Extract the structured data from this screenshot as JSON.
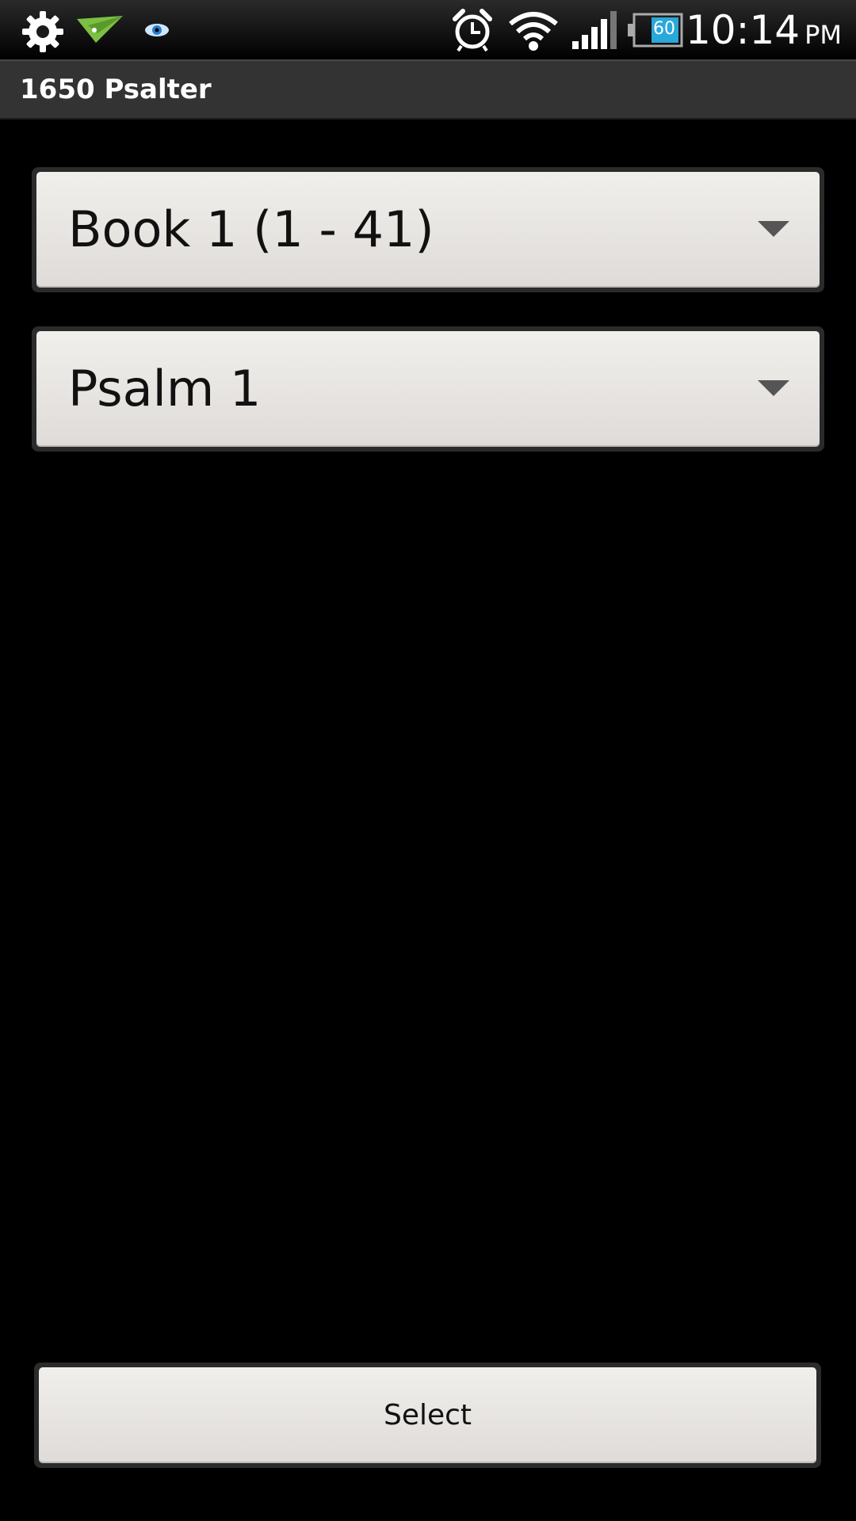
{
  "status_bar": {
    "time": "10:14",
    "ampm": "PM",
    "battery_level": "60",
    "icons": [
      "gear-icon",
      "paper-plane-icon",
      "eye-icon",
      "alarm-clock-icon",
      "wifi-icon",
      "signal-icon",
      "battery-icon"
    ]
  },
  "app_bar": {
    "title": "1650 Psalter"
  },
  "main": {
    "book_spinner": {
      "value": "Book 1 (1 - 41)"
    },
    "psalm_spinner": {
      "value": "Psalm 1"
    },
    "select_button": {
      "label": "Select"
    }
  },
  "colors": {
    "background": "#000000",
    "action_bar": "#333333",
    "button_face": "#eeebe7",
    "arrow": "#555555",
    "paper_plane_green": "#7bc043",
    "eye_blue": "#2a7fd0",
    "battery_fill": "#29a8d9"
  }
}
